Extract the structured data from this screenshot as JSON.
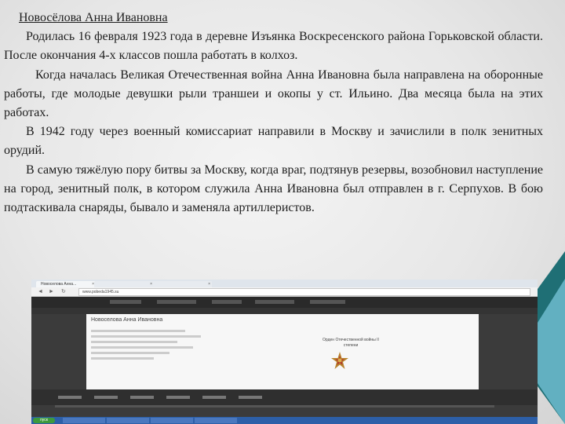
{
  "text": {
    "name_line": "Новосёлова Анна Ивановна",
    "p1": "Родилась 16 февраля 1923 года в деревне Изъянка Воскресенского района Горьковской области. После окончания 4-х классов пошла работать в колхоз.",
    "p2": "Когда началась Великая Отечественная война Анна Ивановна была направлена на оборонные работы, где молодые девушки рыли траншеи и окопы у ст. Ильино. Два месяца была на этих работах.",
    "p3": "В 1942 году через военный комиссариат направили в Москву и зачислили в полк зенитных орудий.",
    "p4": "В самую тяжёлую пору битвы за Москву, когда враг, подтянув резервы, возобновил наступление на город, зенитный полк, в котором служила Анна Ивановна был отправлен в г. Серпухов. В бою подтаскивала снаряды, бывало и заменяла артиллеристов."
  },
  "screenshot": {
    "tab_label": "Новоселова Анна...",
    "url": "www.pobeda1945.su",
    "card_title": "Новоселова Анна Ивановна",
    "award": "Орден Отечественной войны II степени",
    "taskbar_start": "пуск",
    "colors": {
      "accent_teal": "#1f6f75",
      "deco_light": "#62b0c1",
      "taskbar": "#2d5fa8"
    }
  }
}
